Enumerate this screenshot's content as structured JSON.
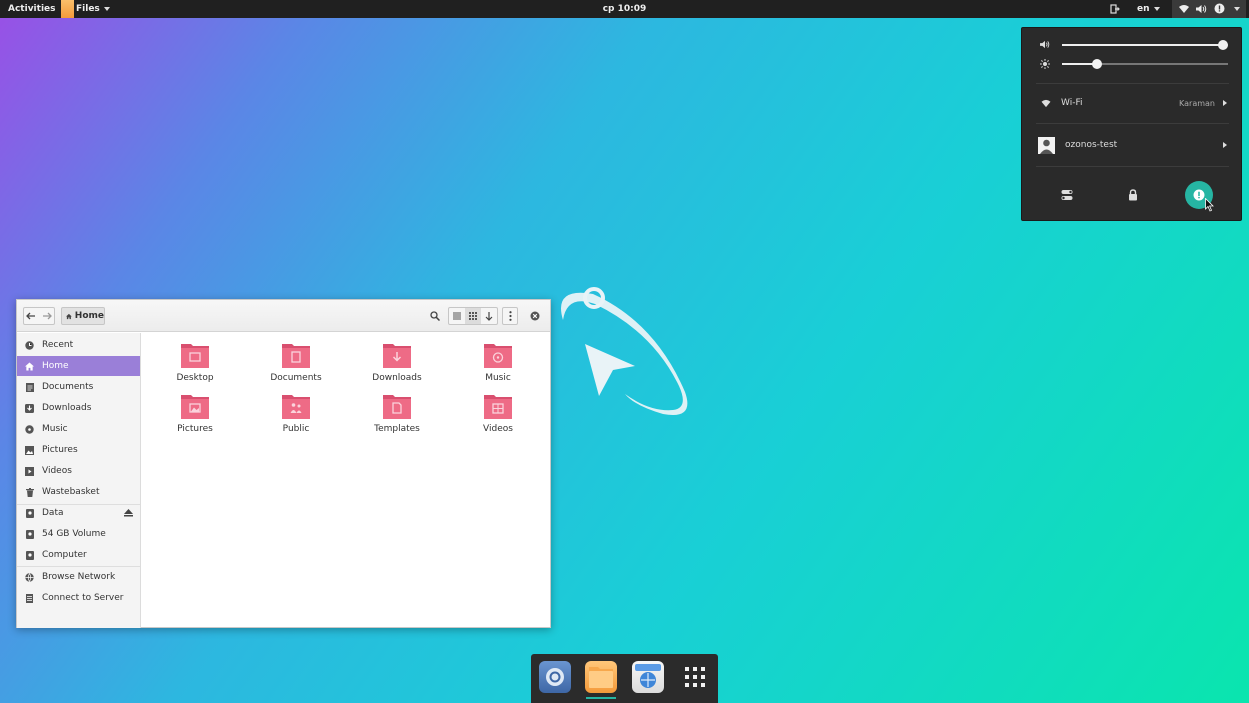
{
  "topbar": {
    "activities": "Activities",
    "app_name": "Files",
    "clock": "cp 10:09",
    "keyboard_layout": "en"
  },
  "system_menu": {
    "volume_level": 0.97,
    "brightness_level": 0.21,
    "wifi_label": "Wi-Fi",
    "wifi_network": "Karaman",
    "user_name": "ozonos-test"
  },
  "files_window": {
    "path_label": "Home",
    "sidebar": [
      {
        "label": "Recent",
        "icon": "clock-icon"
      },
      {
        "label": "Home",
        "icon": "home-icon"
      },
      {
        "label": "Documents",
        "icon": "document-icon"
      },
      {
        "label": "Downloads",
        "icon": "download-icon"
      },
      {
        "label": "Music",
        "icon": "music-icon"
      },
      {
        "label": "Pictures",
        "icon": "picture-icon"
      },
      {
        "label": "Videos",
        "icon": "video-icon"
      },
      {
        "label": "Wastebasket",
        "icon": "trash-icon"
      },
      {
        "label": "Data",
        "icon": "drive-icon"
      },
      {
        "label": "54 GB Volume",
        "icon": "drive-icon"
      },
      {
        "label": "Computer",
        "icon": "computer-icon"
      },
      {
        "label": "Browse Network",
        "icon": "network-icon"
      },
      {
        "label": "Connect to Server",
        "icon": "server-icon"
      }
    ],
    "folders": [
      {
        "label": "Desktop",
        "icon": "desktop-folder-icon"
      },
      {
        "label": "Documents",
        "icon": "documents-folder-icon"
      },
      {
        "label": "Downloads",
        "icon": "downloads-folder-icon"
      },
      {
        "label": "Music",
        "icon": "music-folder-icon"
      },
      {
        "label": "Pictures",
        "icon": "pictures-folder-icon"
      },
      {
        "label": "Public",
        "icon": "public-folder-icon"
      },
      {
        "label": "Templates",
        "icon": "templates-folder-icon"
      },
      {
        "label": "Videos",
        "icon": "videos-folder-icon"
      }
    ]
  },
  "colors": {
    "accent": "#9a7fd8",
    "folder": "#ee6b86",
    "power_button": "#26b5a3",
    "panel": "#202020"
  }
}
